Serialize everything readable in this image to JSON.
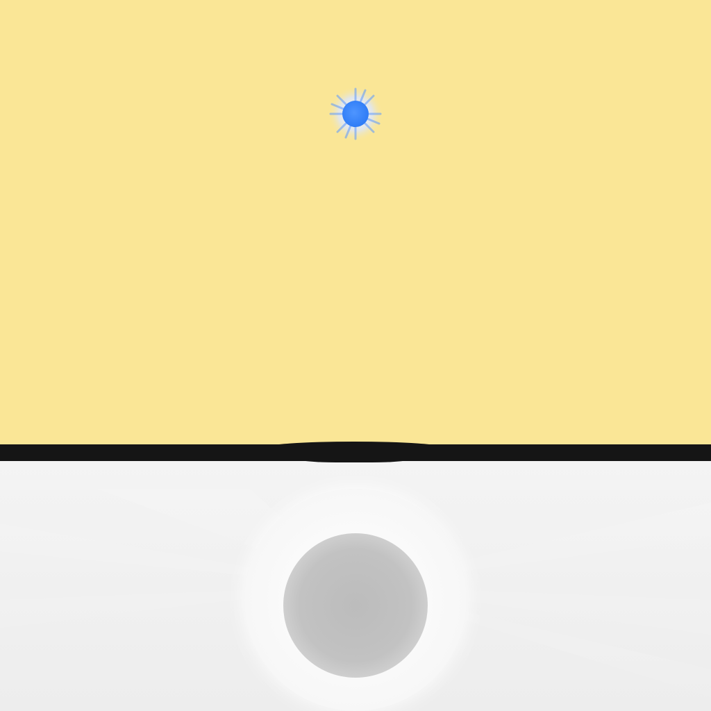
{
  "colors": {
    "sky": "#fae696",
    "horizon": "#151515",
    "ground": "#f2f2f2",
    "ball": "#3a86ff",
    "ball_glow": "#bcd4ff",
    "hole": "#bdbdbd"
  },
  "icons": {
    "ball": "glowing-ball-icon",
    "target": "hole-icon"
  }
}
